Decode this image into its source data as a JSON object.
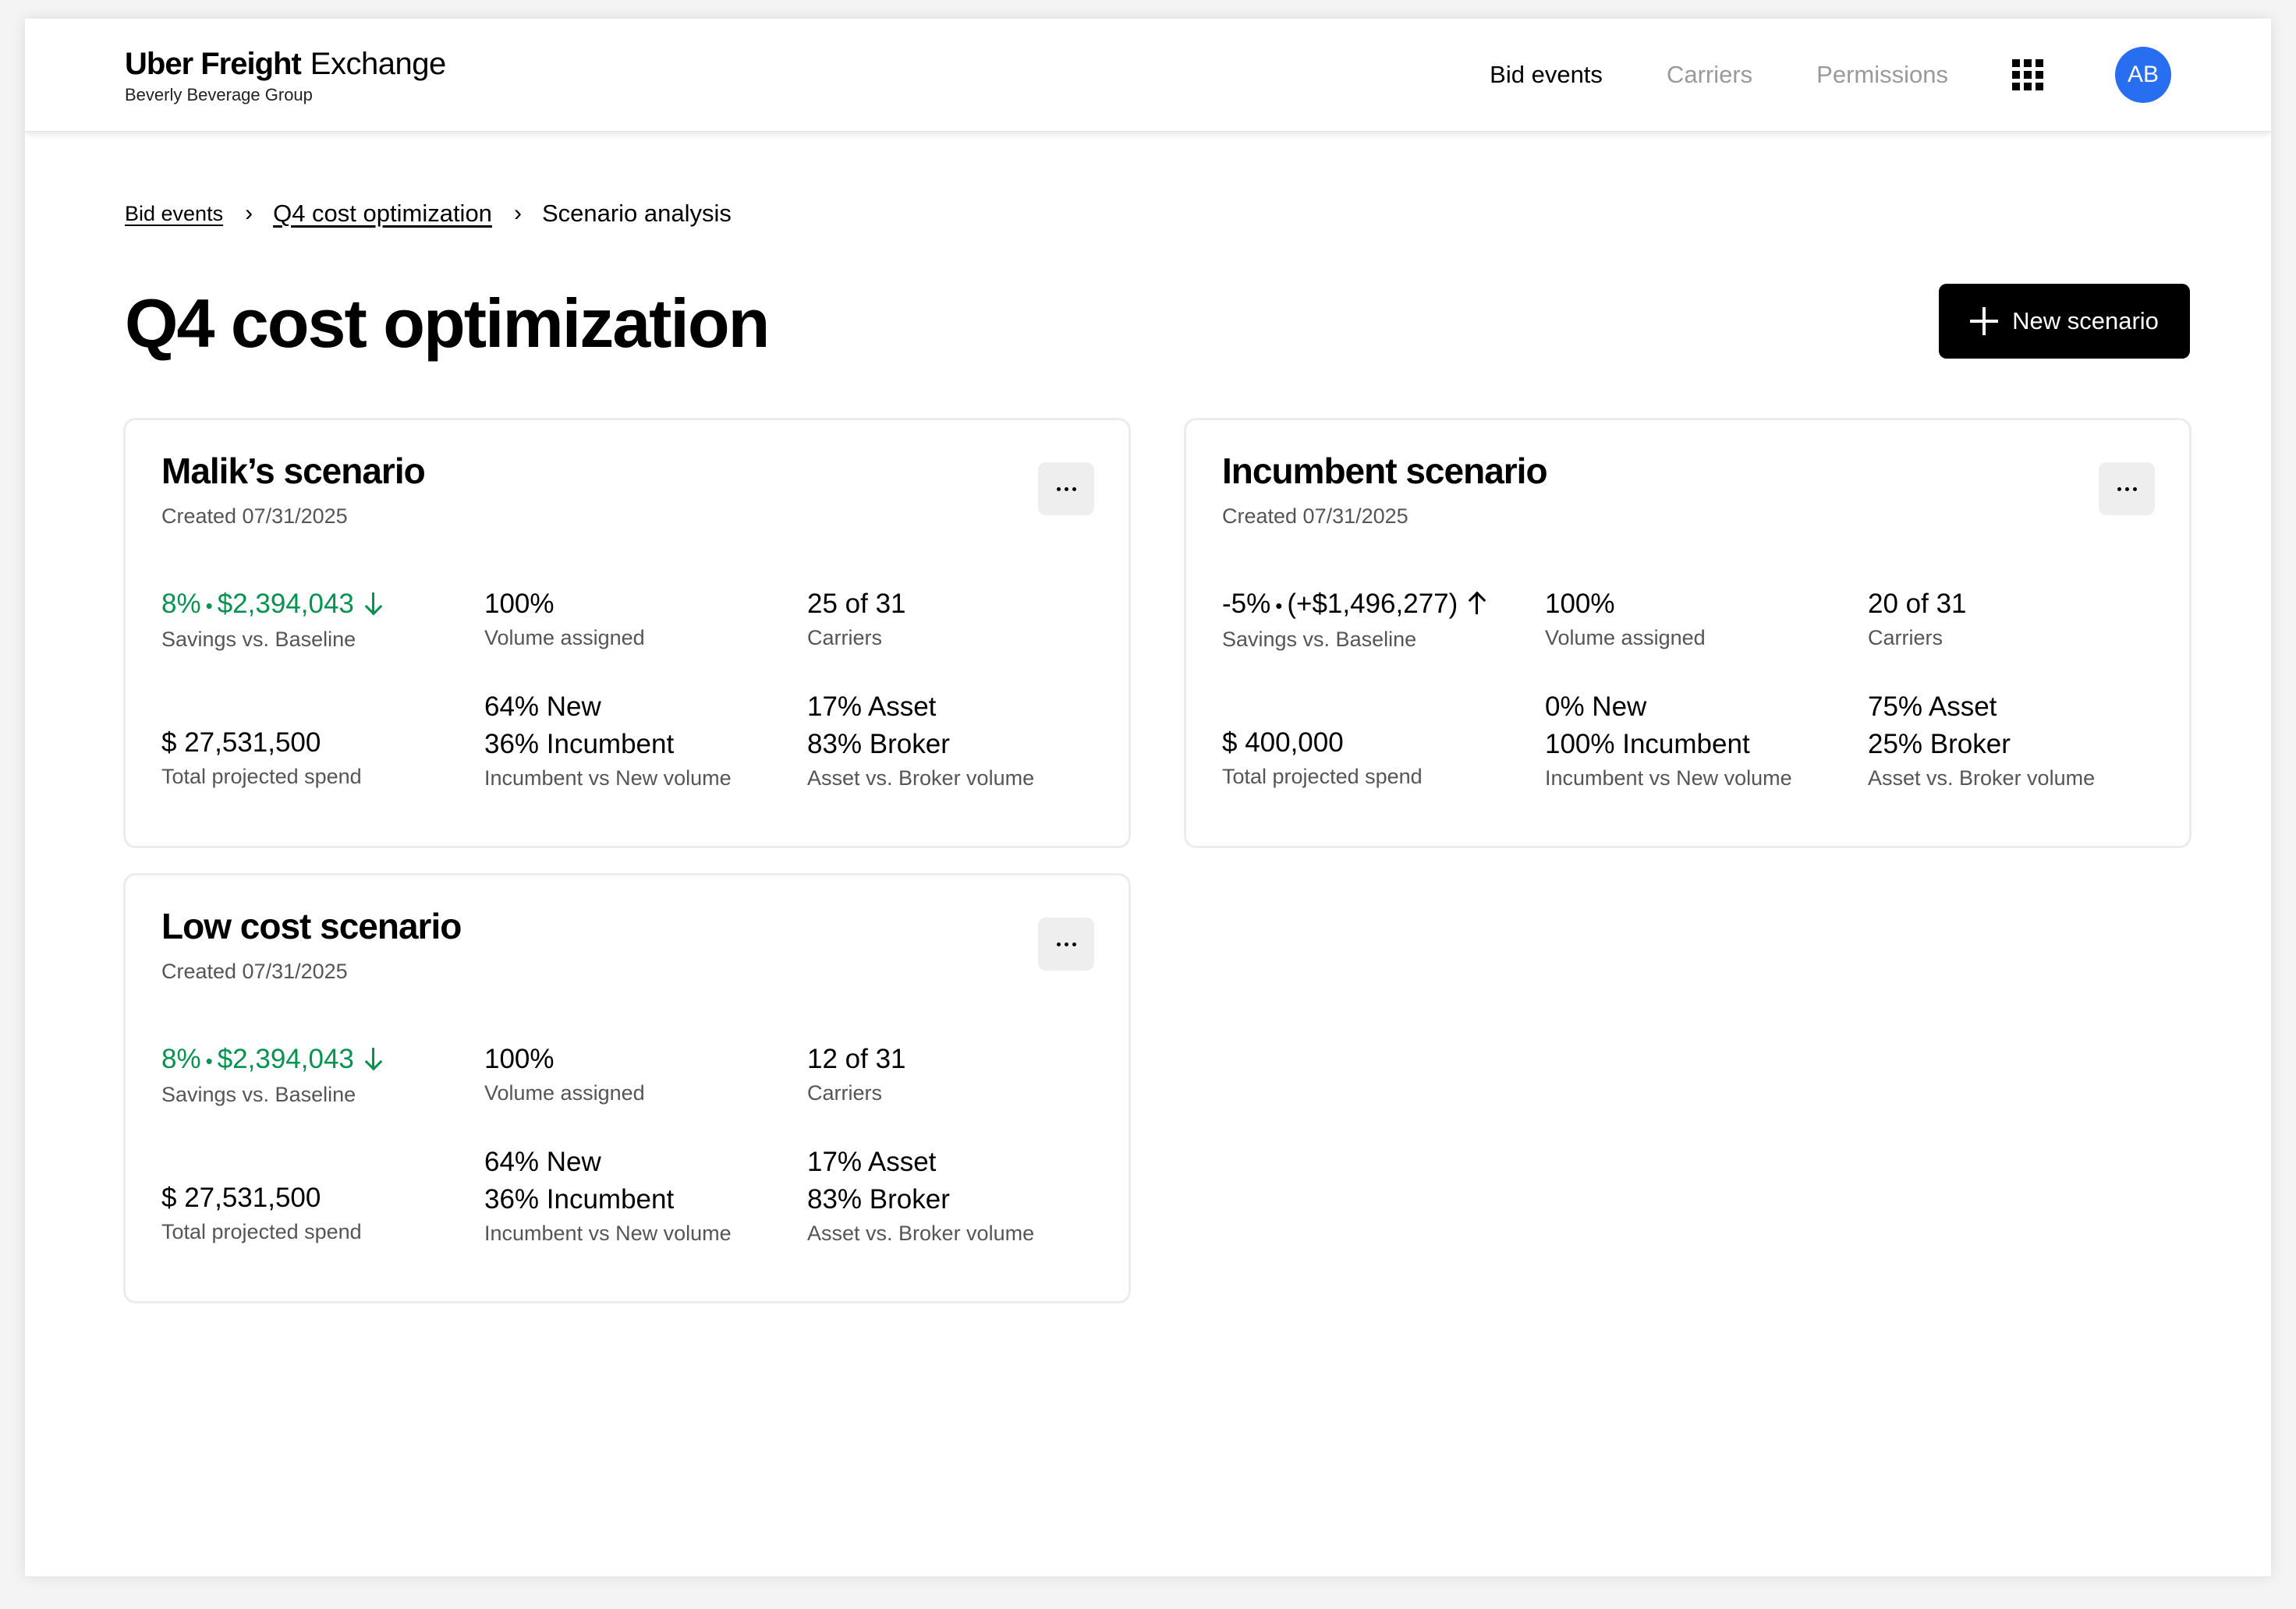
{
  "header": {
    "brand_bold": "Uber Freight",
    "brand_light": "Exchange",
    "org": "Beverly Beverage Group",
    "nav": [
      {
        "label": "Bid events"
      },
      {
        "label": "Carriers"
      },
      {
        "label": "Permissions"
      }
    ],
    "avatar_initials": "AB"
  },
  "breadcrumb": {
    "items": [
      "Bid events",
      "Q4 cost optimization",
      "Scenario analysis"
    ]
  },
  "page": {
    "title": "Q4 cost optimization",
    "new_button_label": "New scenario"
  },
  "cards": [
    {
      "name": "Malik’s scenario",
      "created": "Created 07/31/2025",
      "savings_pct": "8%",
      "savings_amount": "$2,394,043",
      "savings_direction": "down",
      "savings_label": "Savings vs. Baseline",
      "volume_value": "100%",
      "volume_label": "Volume assigned",
      "carriers_value": "25 of 31",
      "carriers_label": "Carriers",
      "spend_value": "$ 27,531,500",
      "spend_label": "Total projected spend",
      "new_pct": "64% New",
      "incumbent_pct": "36% Incumbent",
      "incumbent_label": "Incumbent vs New volume",
      "asset_pct": "17% Asset",
      "broker_pct": "83% Broker",
      "asset_label": "Asset vs. Broker volume"
    },
    {
      "name": "Incumbent scenario",
      "created": "Created 07/31/2025",
      "savings_pct": "-5%",
      "savings_amount": "(+$1,496,277)",
      "savings_direction": "up",
      "savings_label": "Savings vs. Baseline",
      "volume_value": "100%",
      "volume_label": "Volume assigned",
      "carriers_value": "20 of 31",
      "carriers_label": "Carriers",
      "spend_value": "$ 400,000",
      "spend_label": "Total projected spend",
      "new_pct": "0% New",
      "incumbent_pct": "100% Incumbent",
      "incumbent_label": "Incumbent vs New volume",
      "asset_pct": "75% Asset",
      "broker_pct": "25% Broker",
      "asset_label": "Asset vs. Broker volume"
    },
    {
      "name": "Low cost scenario",
      "created": "Created 07/31/2025",
      "savings_pct": "8%",
      "savings_amount": "$2,394,043",
      "savings_direction": "down",
      "savings_label": "Savings vs. Baseline",
      "volume_value": "100%",
      "volume_label": "Volume assigned",
      "carriers_value": "12 of 31",
      "carriers_label": "Carriers",
      "spend_value": "$ 27,531,500",
      "spend_label": "Total projected spend",
      "new_pct": "64% New",
      "incumbent_pct": "36% Incumbent",
      "incumbent_label": "Incumbent vs New volume",
      "asset_pct": "17% Asset",
      "broker_pct": "83% Broker",
      "asset_label": "Asset vs. Broker volume"
    }
  ],
  "icons": {
    "apps": "grid-icon",
    "more": "more-horizontal-icon",
    "plus": "plus-icon",
    "savings_down": "arrow-down-icon",
    "savings_up": "arrow-up-icon"
  },
  "colors": {
    "savings_positive": "#05944f",
    "avatar": "#276ef1",
    "primary_button": "#000000"
  }
}
